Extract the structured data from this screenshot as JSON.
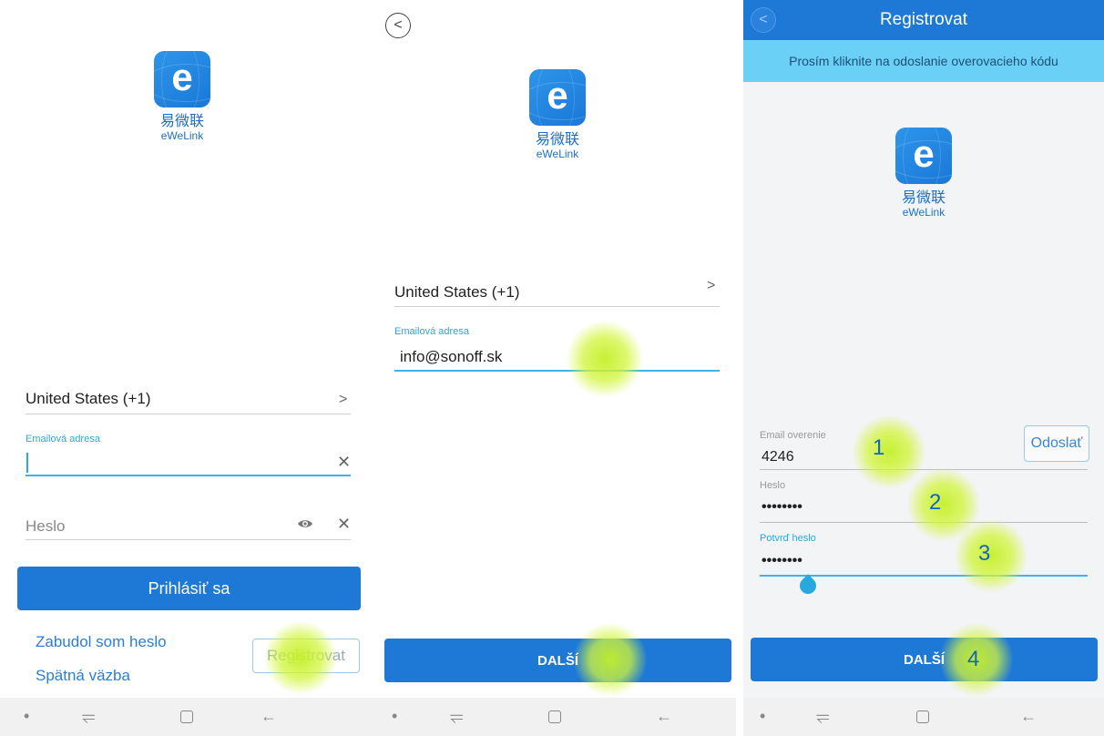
{
  "brand": {
    "letter": "e",
    "name_cn": "易微联",
    "name_en": "eWeLink"
  },
  "screen1": {
    "country": "United States (+1)",
    "email_label": "Emailová adresa",
    "password_placeholder": "Heslo",
    "login_button": "Prihlásiť sa",
    "forgot_link": "Zabudol som heslo",
    "feedback_link": "Spätná väzba",
    "register_button": "Registrovat"
  },
  "screen2": {
    "country": "United States (+1)",
    "email_label": "Emailová adresa",
    "email_value": "info@sonoff.sk",
    "next_button": "DALŠÍ"
  },
  "screen3": {
    "title": "Registrovat",
    "banner": "Prosím kliknite na odoslanie overovacieho kódu",
    "code_label": "Email overenie",
    "code_value": "4246",
    "send_button": "Odoslať",
    "password_label": "Heslo",
    "password_value": "••••••••",
    "confirm_label": "Potvrď heslo",
    "confirm_value": "••••••••",
    "next_button": "DALŠÍ",
    "step_numbers": [
      "1",
      "2",
      "3",
      "4"
    ]
  },
  "nav_icons": [
    "dot-icon",
    "recent-apps-icon",
    "home-icon",
    "back-arrow-icon"
  ],
  "colors": {
    "primary": "#1e78d6",
    "accent": "#3db4e6",
    "banner": "#6ad0f6",
    "highlight": "#c4f028"
  }
}
